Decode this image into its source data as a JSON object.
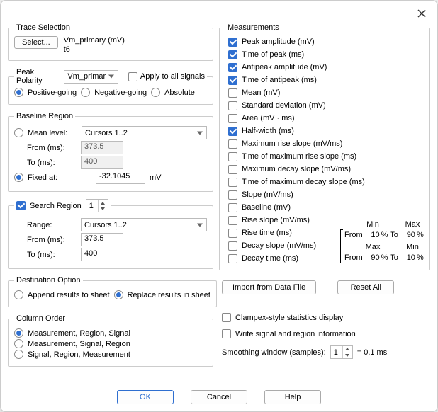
{
  "close_title": "Close",
  "trace_selection": {
    "legend": "Trace Selection",
    "select_btn": "Select...",
    "line1": "Vm_primary (mV)",
    "line2": "t6"
  },
  "peak_polarity": {
    "label": "Peak Polarity",
    "signal": "Vm_primar",
    "apply_all": "Apply to all signals",
    "positive": "Positive-going",
    "negative": "Negative-going",
    "absolute": "Absolute"
  },
  "baseline_region": {
    "legend": "Baseline Region",
    "mean_level": "Mean level:",
    "mean_sel": "Cursors 1..2",
    "from_label": "From (ms):",
    "from_val": "373.5",
    "to_label": "To (ms):",
    "to_val": "400",
    "fixed_label": "Fixed at:",
    "fixed_val": "-32.1045",
    "fixed_unit": "mV"
  },
  "search_region": {
    "label": "Search Region",
    "num": "1",
    "range_label": "Range:",
    "range_sel": "Cursors 1..2",
    "from_label": "From (ms):",
    "from_val": "373.5",
    "to_label": "To (ms):",
    "to_val": "400"
  },
  "destination": {
    "legend": "Destination Option",
    "append": "Append results to sheet",
    "replace": "Replace results in sheet"
  },
  "column_order": {
    "legend": "Column Order",
    "o1": "Measurement, Region, Signal",
    "o2": "Measurement, Signal, Region",
    "o3": "Signal, Region, Measurement"
  },
  "measurements": {
    "legend": "Measurements",
    "items": [
      {
        "label": "Peak amplitude (mV)",
        "checked": true
      },
      {
        "label": "Time of peak (ms)",
        "checked": true
      },
      {
        "label": "Antipeak amplitude (mV)",
        "checked": true
      },
      {
        "label": "Time of antipeak (ms)",
        "checked": true
      },
      {
        "label": "Mean (mV)",
        "checked": false
      },
      {
        "label": "Standard deviation (mV)",
        "checked": false
      },
      {
        "label": "Area (mV · ms)",
        "checked": false
      },
      {
        "label": "Half-width (ms)",
        "checked": true
      },
      {
        "label": "Maximum rise slope (mV/ms)",
        "checked": false
      },
      {
        "label": "Time of maximum rise slope (ms)",
        "checked": false
      },
      {
        "label": "Maximum decay slope (mV/ms)",
        "checked": false
      },
      {
        "label": "Time of maximum decay slope (ms)",
        "checked": false
      },
      {
        "label": "Slope (mV/ms)",
        "checked": false
      },
      {
        "label": "Baseline (mV)",
        "checked": false
      },
      {
        "label": "Rise slope (mV/ms)",
        "checked": false
      },
      {
        "label": "Rise time (ms)",
        "checked": false
      },
      {
        "label": "Decay slope (mV/ms)",
        "checked": false
      },
      {
        "label": "Decay time (ms)",
        "checked": false
      }
    ],
    "slope_from": "From",
    "slope_to": "% To",
    "slope_pct": "%",
    "min_label": "Min",
    "max_label": "Max",
    "rise_min": "10",
    "rise_max": "90",
    "decay_l": "90",
    "decay_r": "10"
  },
  "right_buttons": {
    "import": "Import from Data File",
    "reset": "Reset All"
  },
  "bottom": {
    "clampex": "Clampex-style statistics display",
    "write_sig": "Write signal and region information",
    "smooth_label": "Smoothing window (samples):",
    "smooth_val": "1",
    "smooth_eq": "= 0.1 ms"
  },
  "footer": {
    "ok": "OK",
    "cancel": "Cancel",
    "help": "Help"
  }
}
